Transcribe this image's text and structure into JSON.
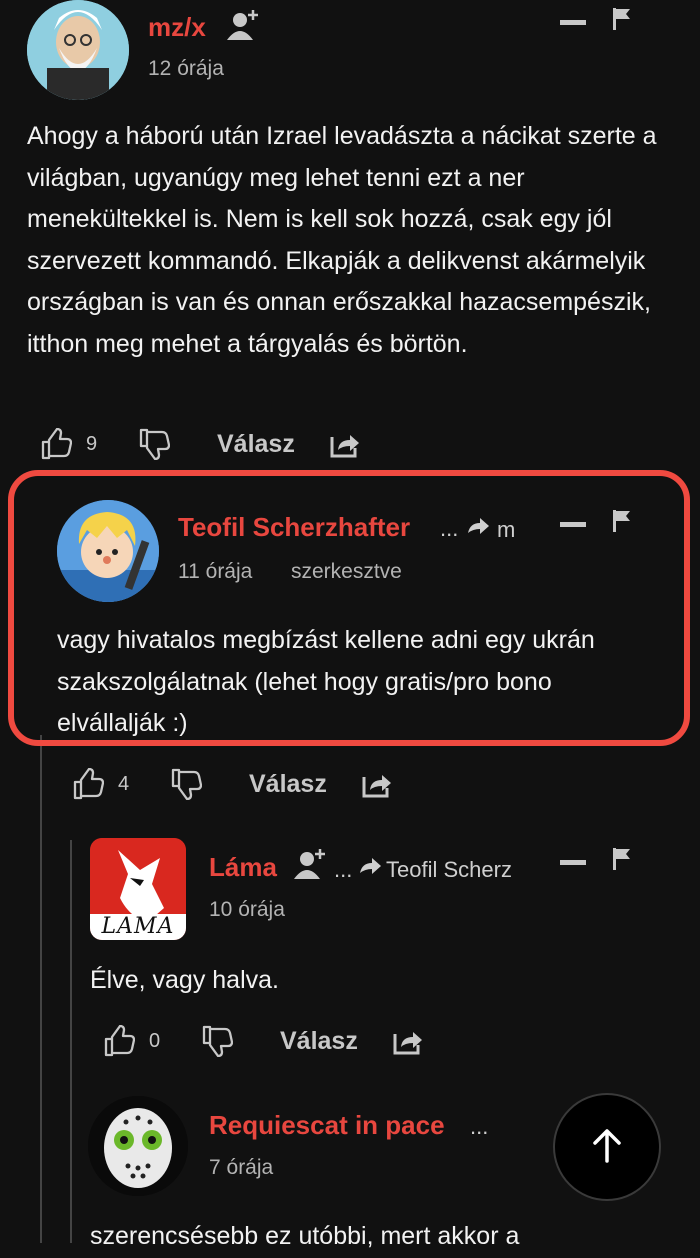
{
  "comments": [
    {
      "author": "mz/x",
      "time": "12 órája",
      "text": "Ahogy a háború után Izrael levadászta a nácikat szerte a világban, ugyanúgy meg lehet tenni ezt a ner menekültekkel is. Nem is kell sok hozzá, csak egy jól szervezett kommandó. Elkapják a delikvenst akármelyik országban is van és onnan erőszakkal hazacsempészik, itthon meg mehet a tárgyalás és börtön.",
      "likes": "9",
      "reply_label": "Válasz"
    },
    {
      "author": "Teofil Scherzhafter",
      "ellipsis": "...",
      "reply_to": "m",
      "time": "11 órája",
      "edited": "szerkesztve",
      "text": "vagy hivatalos megbízást kellene adni egy ukrán szakszolgálatnak (lehet hogy gratis/pro bono elvállalják :)",
      "likes": "4",
      "reply_label": "Válasz"
    },
    {
      "author": "Láma",
      "ellipsis": "...",
      "reply_to": "Teofil Scherz",
      "time": "10 órája",
      "avatar_text": "LAMA",
      "text": "Élve, vagy halva.",
      "likes": "0",
      "reply_label": "Válasz"
    },
    {
      "author": "Requiescat in pace",
      "ellipsis": "...",
      "time": "7 órája",
      "text": "szerencsésebb ez utóbbi, mert akkor a"
    }
  ],
  "colors": {
    "background": "#111111",
    "author": "#e8473f",
    "highlight": "#f04a40"
  },
  "icons": [
    "add-user-icon",
    "minimize-icon",
    "flag-icon",
    "thumbs-up-icon",
    "thumbs-down-icon",
    "share-icon",
    "reply-arrow-icon",
    "arrow-up-icon"
  ]
}
